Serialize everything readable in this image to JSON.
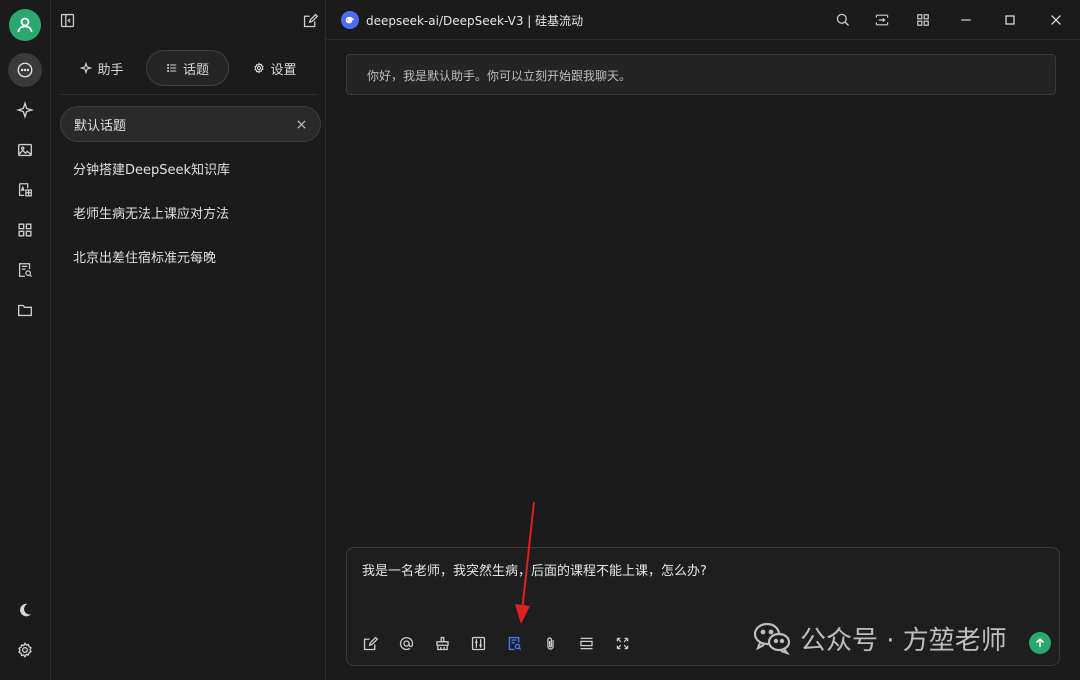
{
  "colors": {
    "background": "#1b1b1b",
    "accent": "#2aa870",
    "highlight_tool": "#3d7bff",
    "arrow": "#e02020",
    "model_logo": "#4e6bf5"
  },
  "rail": {
    "items": [
      {
        "name": "chat",
        "icon": "chat-bubble-icon",
        "active": true
      },
      {
        "name": "agents",
        "icon": "sparkle-icon"
      },
      {
        "name": "images",
        "icon": "image-icon"
      },
      {
        "name": "translate",
        "icon": "translate-icon"
      },
      {
        "name": "apps",
        "icon": "grid-icon"
      },
      {
        "name": "knowledge",
        "icon": "document-search-icon"
      },
      {
        "name": "files",
        "icon": "folder-icon"
      }
    ],
    "bottom": [
      {
        "name": "theme",
        "icon": "moon-icon"
      },
      {
        "name": "settings",
        "icon": "gear-icon"
      }
    ]
  },
  "panel": {
    "tabs": [
      {
        "label": "助手",
        "icon": "sparkle-icon"
      },
      {
        "label": "话题",
        "icon": "list-icon",
        "active": true
      },
      {
        "label": "设置",
        "icon": "gear-icon"
      }
    ],
    "topics": [
      {
        "label": "默认话题",
        "active": true
      },
      {
        "label": "分钟搭建DeepSeek知识库"
      },
      {
        "label": "老师生病无法上课应对方法"
      },
      {
        "label": "北京出差住宿标准元每晚"
      }
    ]
  },
  "titlebar": {
    "model": "deepseek-ai/DeepSeek-V3 | 硅基流动"
  },
  "chat": {
    "greeting": "你好，我是默认助手。你可以立刻开始跟我聊天。"
  },
  "composer": {
    "text": "我是一名老师，我突然生病，后面的课程不能上课，怎么办?",
    "tools": [
      "new-topic-icon",
      "mention-icon",
      "broom-icon",
      "sliders-icon",
      "knowledge-base-icon",
      "paperclip-icon",
      "expand-lines-icon",
      "fullscreen-icon"
    ]
  },
  "watermark": {
    "text": "公众号 · 方堃老师"
  }
}
